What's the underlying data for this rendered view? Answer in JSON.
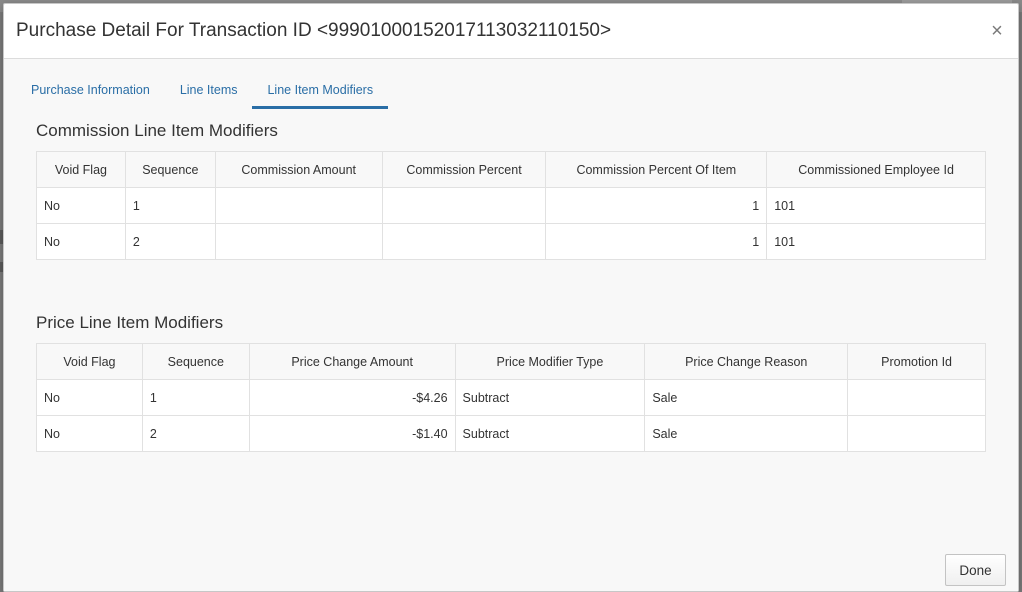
{
  "dialog": {
    "title": "Purchase Detail For Transaction ID <99901000152017113032110150>",
    "close_symbol": "×"
  },
  "tabs": [
    {
      "label": "Purchase Information",
      "active": false
    },
    {
      "label": "Line Items",
      "active": false
    },
    {
      "label": "Line Item Modifiers",
      "active": true
    }
  ],
  "commission": {
    "title": "Commission Line Item Modifiers",
    "headers": [
      "Void Flag",
      "Sequence",
      "Commission Amount",
      "Commission Percent",
      "Commission Percent Of Item",
      "Commissioned Employee Id"
    ],
    "rows": [
      [
        "No",
        "1",
        "",
        "",
        "1",
        "101"
      ],
      [
        "No",
        "2",
        "",
        "",
        "1",
        "101"
      ]
    ]
  },
  "price": {
    "title": "Price Line Item Modifiers",
    "headers": [
      "Void Flag",
      "Sequence",
      "Price Change Amount",
      "Price Modifier Type",
      "Price Change Reason",
      "Promotion Id"
    ],
    "rows": [
      [
        "No",
        "1",
        "-$4.26",
        "Subtract",
        "Sale",
        ""
      ],
      [
        "No",
        "2",
        "-$1.40",
        "Subtract",
        "Sale",
        ""
      ]
    ]
  },
  "footer": {
    "done_label": "Done"
  },
  "colors": {
    "tab_accent": "#2a6ea6",
    "text": "#333333"
  }
}
